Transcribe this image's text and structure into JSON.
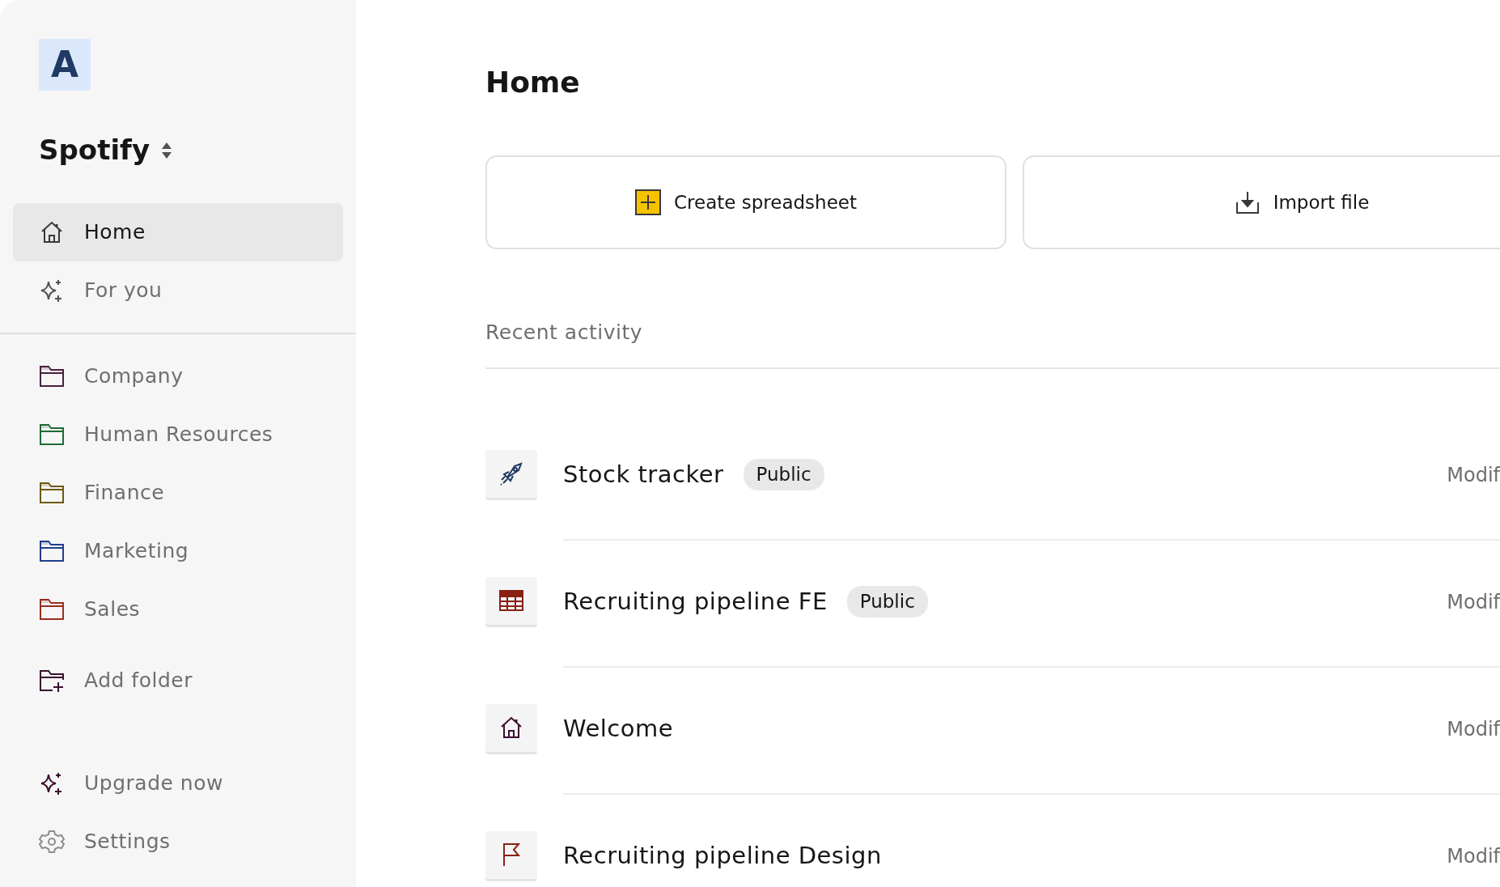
{
  "sidebar": {
    "logo": "A",
    "workspace": "Spotify",
    "nav": [
      {
        "label": "Home",
        "kind": "home",
        "selected": true
      },
      {
        "label": "For you",
        "kind": "sparkle",
        "selected": false
      }
    ],
    "folders": [
      {
        "label": "Company",
        "color": "#4a1f3d"
      },
      {
        "label": "Human Resources",
        "color": "#1e6b35"
      },
      {
        "label": "Finance",
        "color": "#6b5a10"
      },
      {
        "label": "Marketing",
        "color": "#1f3d8a"
      },
      {
        "label": "Sales",
        "color": "#9a2e1e"
      }
    ],
    "add_folder": "Add folder",
    "footer": [
      {
        "label": "Upgrade now",
        "kind": "sparkle"
      },
      {
        "label": "Settings",
        "kind": "settings"
      }
    ]
  },
  "main": {
    "title": "Home",
    "actions": [
      {
        "label": "Create spreadsheet",
        "kind": "create"
      },
      {
        "label": "Import file",
        "kind": "import"
      }
    ],
    "section": "Recent activity",
    "rows": [
      {
        "kind": "rocket",
        "title": "Stock tracker",
        "badge": "Public",
        "modified": "Modif"
      },
      {
        "kind": "table",
        "title": "Recruiting pipeline FE",
        "badge": "Public",
        "modified": "Modif"
      },
      {
        "kind": "home",
        "title": "Welcome",
        "modified": "Modif"
      },
      {
        "kind": "flag",
        "title": "Recruiting pipeline Design",
        "modified": "Modif"
      }
    ]
  }
}
